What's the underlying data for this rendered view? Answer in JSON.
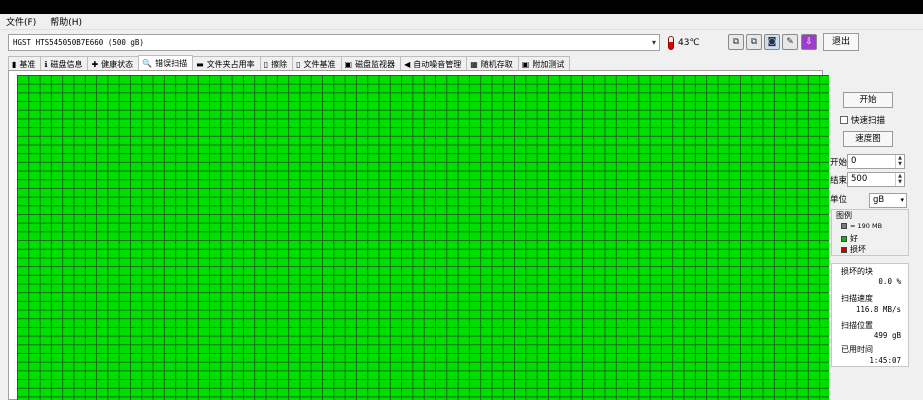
{
  "menu": [
    "文件(F)",
    "帮助(H)"
  ],
  "device": {
    "selected": "HGST HTS545050B7E660 (500 gB)",
    "temperature": "43℃"
  },
  "toolbar": {
    "exit_label": "退出"
  },
  "tabs": [
    {
      "label": "基准",
      "icon": "benchmark-icon",
      "glyph": "▮"
    },
    {
      "label": "磁盘信息",
      "icon": "info-icon",
      "glyph": "ℹ"
    },
    {
      "label": "健康状态",
      "icon": "health-cross-icon",
      "glyph": "✚"
    },
    {
      "label": "错误扫描",
      "icon": "magnifier-icon",
      "glyph": "🔍",
      "active": true
    },
    {
      "label": "文件夹占用率",
      "icon": "folder-icon",
      "glyph": "▬"
    },
    {
      "label": "擦除",
      "icon": "trash-icon",
      "glyph": "▯"
    },
    {
      "label": "文件基准",
      "icon": "file-bench-icon",
      "glyph": "▯"
    },
    {
      "label": "磁盘监视器",
      "icon": "monitor-icon",
      "glyph": "▣"
    },
    {
      "label": "自动噪音管理",
      "icon": "speaker-icon",
      "glyph": "◀"
    },
    {
      "label": "随机存取",
      "icon": "random-access-icon",
      "glyph": "▦"
    },
    {
      "label": "附加测试",
      "icon": "extra-tests-icon",
      "glyph": "▣"
    }
  ],
  "side": {
    "start_button": "开始",
    "quick_scan_label": "快速扫描",
    "quick_scan_checked": false,
    "speed_chart_button": "速度图",
    "start_label": "开始",
    "start_value": "0",
    "end_label": "结束",
    "end_value": "500",
    "unit_label": "单位",
    "unit_value": "gB",
    "legend_title": "图例",
    "legend_block_size": "= 190 MB",
    "legend_good": "好",
    "legend_bad": "损坏",
    "damaged_label": "损坏的块",
    "damaged_value": "0.0 %",
    "scan_speed_label": "扫描速度",
    "scan_speed_value": "116.8 MB/s",
    "scan_pos_label": "扫描位置",
    "scan_pos_value": "499 gB",
    "elapsed_label": "已用时间",
    "elapsed_value": "1:45:07"
  },
  "colors": {
    "good": "#00e000",
    "bad": "#cc0000",
    "grid_line": "#1a6a1a"
  },
  "scan": {
    "blocks_bad": 0
  }
}
